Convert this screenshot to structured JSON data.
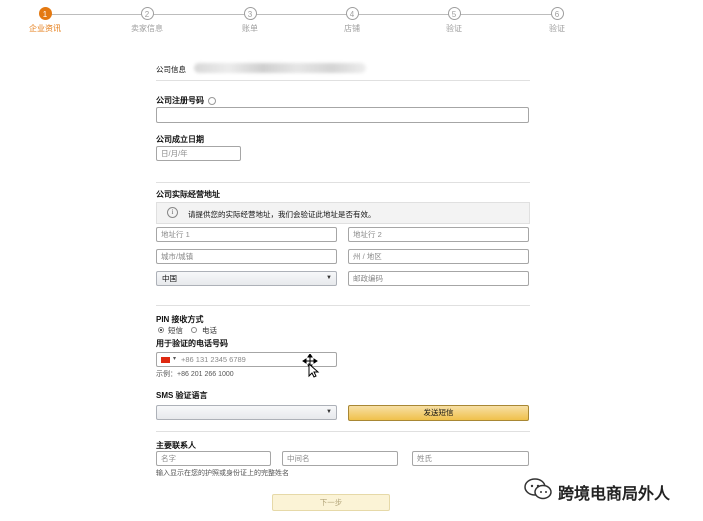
{
  "stepper": {
    "steps": [
      {
        "number": "1",
        "label": "企业资讯"
      },
      {
        "number": "2",
        "label": "卖家信息"
      },
      {
        "number": "3",
        "label": "账单"
      },
      {
        "number": "4",
        "label": "店铺"
      },
      {
        "number": "5",
        "label": "验证"
      },
      {
        "number": "6",
        "label": "验证"
      }
    ],
    "active_index": 0,
    "accent_color": "#e47911"
  },
  "company": {
    "info_label": "公司信息",
    "reg_number_label": "公司注册号码",
    "reg_number_value": "",
    "established_label": "公司成立日期",
    "established_placeholder": "日/月/年"
  },
  "address": {
    "title": "公司实际经营地址",
    "notice": "请提供您的实际经营地址，我们会验证此地址是否有效。",
    "line1_placeholder": "地址行 1",
    "line2_placeholder": "地址行 2",
    "city_placeholder": "城市/城镇",
    "state_placeholder": "州 / 地区",
    "country_value": "中国",
    "postal_placeholder": "邮政编码"
  },
  "pin": {
    "title": "PIN 接收方式",
    "option_sms": "短信",
    "option_phone": "电话",
    "selected": "短信",
    "phone_label": "用于验证的电话号码",
    "phone_placeholder": "+86 131 2345 6789",
    "phone_example": "示例：+86 201 266 1000"
  },
  "sms": {
    "title": "SMS 验证语言",
    "language_value": "",
    "send_button": "发送短信",
    "button_color": "#f0c14b"
  },
  "contact": {
    "title": "主要联系人",
    "first_name_placeholder": "名字",
    "middle_name_placeholder": "中间名",
    "last_name_placeholder": "姓氏",
    "hint": "输入显示在您的护照或身份证上的完整姓名"
  },
  "footer": {
    "next_button": "下一步"
  },
  "watermark": {
    "text": "跨境电商局外人"
  }
}
